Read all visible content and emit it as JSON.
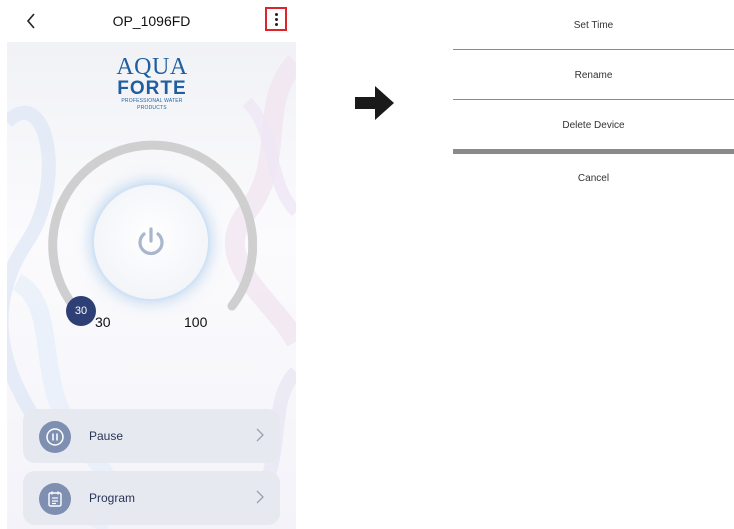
{
  "header": {
    "title": "OP_1096FD",
    "back_icon": "chevron-left-icon",
    "more_icon": "more-vertical-icon",
    "highlight_color": "#e0222b"
  },
  "logo": {
    "line1": "AQUA",
    "line2": "FORTE",
    "tagline": "PROFESSIONAL WATER PRODUCTS",
    "color": "#1f5f9f"
  },
  "dial": {
    "current_value": "30",
    "min_label": "30",
    "max_label": "100",
    "power_icon": "power-icon",
    "knob_color": "#2e3f75"
  },
  "actions": [
    {
      "label": "Pause",
      "icon": "pause-icon"
    },
    {
      "label": "Program",
      "icon": "calendar-icon"
    }
  ],
  "transition_icon": "arrow-right-icon",
  "menu": {
    "items": [
      "Set Time",
      "Rename",
      "Delete Device"
    ],
    "cancel": "Cancel"
  }
}
